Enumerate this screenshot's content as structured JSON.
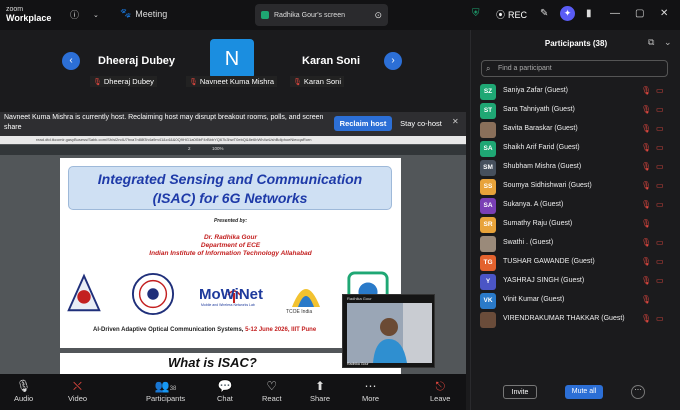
{
  "app": {
    "logo_top": "zoom",
    "logo_bottom": "Workplace"
  },
  "topbar": {
    "meeting_label": "Meeting",
    "screen_share_label": "Radhika Gour's screen",
    "rec_label": "REC"
  },
  "video_strip": {
    "tiles": [
      {
        "name": "Dheeraj Dubey",
        "label": "Dheeraj Dubey"
      },
      {
        "name": "N",
        "label": "Navneet Kuma Mishra"
      },
      {
        "name": "Karan Soni",
        "label": "Karan Soni"
      }
    ]
  },
  "host_banner": {
    "message": "Navneet Kuma Mishra is currently host. Reclaiming host may disrupt breakout rooms, polls, and screen share",
    "reclaim_label": "Reclaim host",
    "cohost_label": "Stay co-host"
  },
  "pdf_viewer": {
    "url": "read.dtd.tkcomlr.gasyBusess/Sabk.com/Sh/sl2ndU7hxa7n88f3h4a9m41&c4&&0Q9HG1a0l5bF4rBbbYQ67k3hwT0ebQ&8e6bWh4wUshBdlphoeNiecqaRorn",
    "page": "2",
    "zoom": "100%"
  },
  "slide": {
    "title_line1": "Integrated Sensing and Communication",
    "title_line2": "(ISAC) for 6G Networks",
    "presented_by": "Presented by:",
    "presenter_name": "Dr. Radhika Gour",
    "department": "Department of ECE",
    "institute": "Indian Institute of Information Technology Allahabad",
    "logo_mowinet": "MoWiNet",
    "logo_mowinet_sub": "Mobile and Wireless Networks Lab",
    "logo_tcoe": "TCOE India",
    "event_text": "AI-Driven Adaptive Optical Communication Systems,",
    "event_date": "5-12 June 2026, IIIT Pune",
    "next_title": "What is ISAC?"
  },
  "camera": {
    "label": "Radhika Gour",
    "name": "Radhika Gour"
  },
  "toolbar": {
    "audio": "Audio",
    "video": "Video",
    "participants": "Participants",
    "participants_count": "38",
    "chat": "Chat",
    "react": "React",
    "share": "Share",
    "more": "More",
    "leave": "Leave"
  },
  "panel": {
    "title": "Participants (38)",
    "search_placeholder": "Find a participant",
    "invite_label": "Invite",
    "mute_all_label": "Mute all",
    "participants": [
      {
        "initials": "SZ",
        "color": "#1fa774",
        "name": "Saniya Zafar (Guest)",
        "video_off": true
      },
      {
        "initials": "ST",
        "color": "#1fa774",
        "name": "Sara Tahniyath (Guest)",
        "video_off": true
      },
      {
        "initials": "",
        "color": "#8a6f5a",
        "name": "Savita Baraskar (Guest)",
        "video_off": true
      },
      {
        "initials": "SA",
        "color": "#1fa774",
        "name": "Shaikh Arif Farid (Guest)",
        "video_off": true
      },
      {
        "initials": "SM",
        "color": "#46505d",
        "name": "Shubham Mishra (Guest)",
        "video_off": true
      },
      {
        "initials": "SS",
        "color": "#e8a33a",
        "name": "Soumya Sidhishwari (Guest)",
        "video_off": true
      },
      {
        "initials": "SA",
        "color": "#7a3fb5",
        "name": "Sukanya. A (Guest)",
        "video_off": true
      },
      {
        "initials": "SR",
        "color": "#e8a33a",
        "name": "Sumathy Raju (Guest)",
        "video_off": false
      },
      {
        "initials": "",
        "color": "#9a8a7a",
        "name": "Swathi . (Guest)",
        "video_off": true
      },
      {
        "initials": "TG",
        "color": "#e3622e",
        "name": "TUSHAR GAWANDE (Guest)",
        "video_off": true
      },
      {
        "initials": "Y",
        "color": "#4b55c5",
        "name": "YASHRAJ SINGH (Guest)",
        "video_off": true
      },
      {
        "initials": "VK",
        "color": "#2a7ac9",
        "name": "Vinit Kumar (Guest)",
        "video_off": false
      },
      {
        "initials": "",
        "color": "#6a4c3a",
        "name": "VIRENDRAKUMAR THAKKAR (Guest)",
        "video_off": true
      }
    ]
  }
}
